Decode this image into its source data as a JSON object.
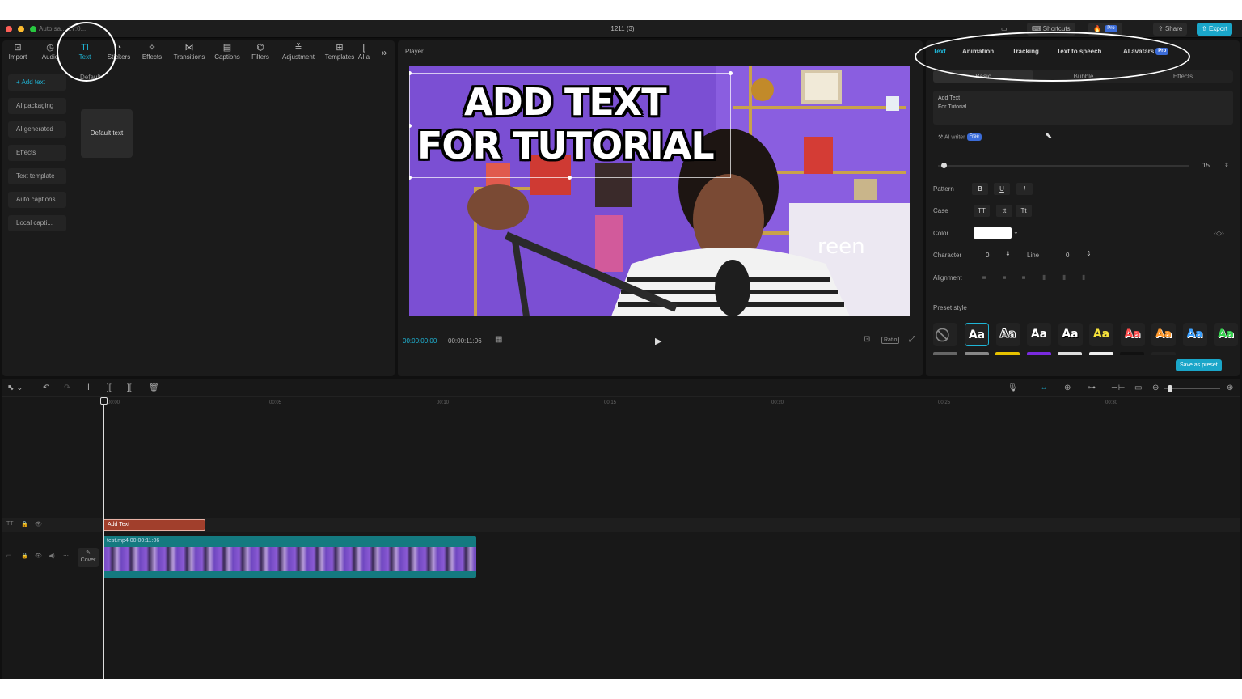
{
  "titlebar": {
    "autosave": "Auto sa... 17:0...",
    "doc_title": "1211 (3)",
    "shortcuts": "Shortcuts",
    "share": "Share",
    "export": "Export",
    "pro": "Pro"
  },
  "left_panel": {
    "tools": [
      {
        "icon": "import-icon",
        "label": "Import"
      },
      {
        "icon": "audio-icon",
        "label": "Audio"
      },
      {
        "icon": "text-icon",
        "label": "Text",
        "active": true
      },
      {
        "icon": "stickers-icon",
        "label": "Stickers"
      },
      {
        "icon": "effects-icon",
        "label": "Effects"
      },
      {
        "icon": "transitions-icon",
        "label": "Transitions"
      },
      {
        "icon": "captions-icon",
        "label": "Captions"
      },
      {
        "icon": "filters-icon",
        "label": "Filters"
      },
      {
        "icon": "adjustment-icon",
        "label": "Adjustment"
      },
      {
        "icon": "templates-icon",
        "label": "Templates"
      },
      {
        "icon": "ai-icon",
        "label": "AI a"
      }
    ],
    "more": "»",
    "categories": [
      "+ Add text",
      "AI packaging",
      "AI generated",
      "Effects",
      "Text template",
      "Auto captions",
      "Local capti..."
    ],
    "default_label": "Default",
    "default_card": "Default text"
  },
  "player": {
    "label": "Player",
    "caption_line1": "ADD TEXT",
    "caption_line2": "FOR TUTORIAL",
    "current_time": "00:00:00:00",
    "duration": "00:00:11:06",
    "ratio": "Ratio",
    "bg_sign": "reen"
  },
  "right_panel": {
    "tabs": [
      "Text",
      "Animation",
      "Tracking",
      "Text to speech",
      "AI avatars"
    ],
    "pro": "Pro",
    "free": "Free",
    "subtabs": [
      "Basic",
      "Bubble",
      "Effects"
    ],
    "text_value_line1": "Add Text",
    "text_value_line2": "For Tutorial",
    "ai_writer": "AI writer",
    "font_size": "15",
    "pattern_label": "Pattern",
    "pattern_buttons": [
      "B",
      "U",
      "I"
    ],
    "case_label": "Case",
    "case_buttons": [
      "TT",
      "tt",
      "Tt"
    ],
    "color_label": "Color",
    "character_label": "Character",
    "character_value": "0",
    "line_label": "Line",
    "line_value": "0",
    "alignment_label": "Alignment",
    "preset_style_label": "Preset style",
    "preset_text": "Aa",
    "save_preset": "Save as preset",
    "preset_colors": [
      "#ffffff",
      "#ffffff",
      "#ffffff",
      "#ffffff",
      "#f5e23b",
      "#ff4d4d",
      "#ff9a2e",
      "#3aa0ff",
      "#35d34f"
    ],
    "strip_colors": [
      "#666666",
      "#888888",
      "#e6c200",
      "#7a2be0",
      "#dddddd",
      "#eeeeee",
      "#111111",
      "#222222"
    ]
  },
  "timeline": {
    "ruler": [
      "00:00",
      "00:05",
      "00:10",
      "00:15",
      "00:20",
      "00:25",
      "00:30"
    ],
    "text_clip": "Add Text",
    "video_clip": "test.mp4  00:00:11:06",
    "cover": "Cover"
  }
}
